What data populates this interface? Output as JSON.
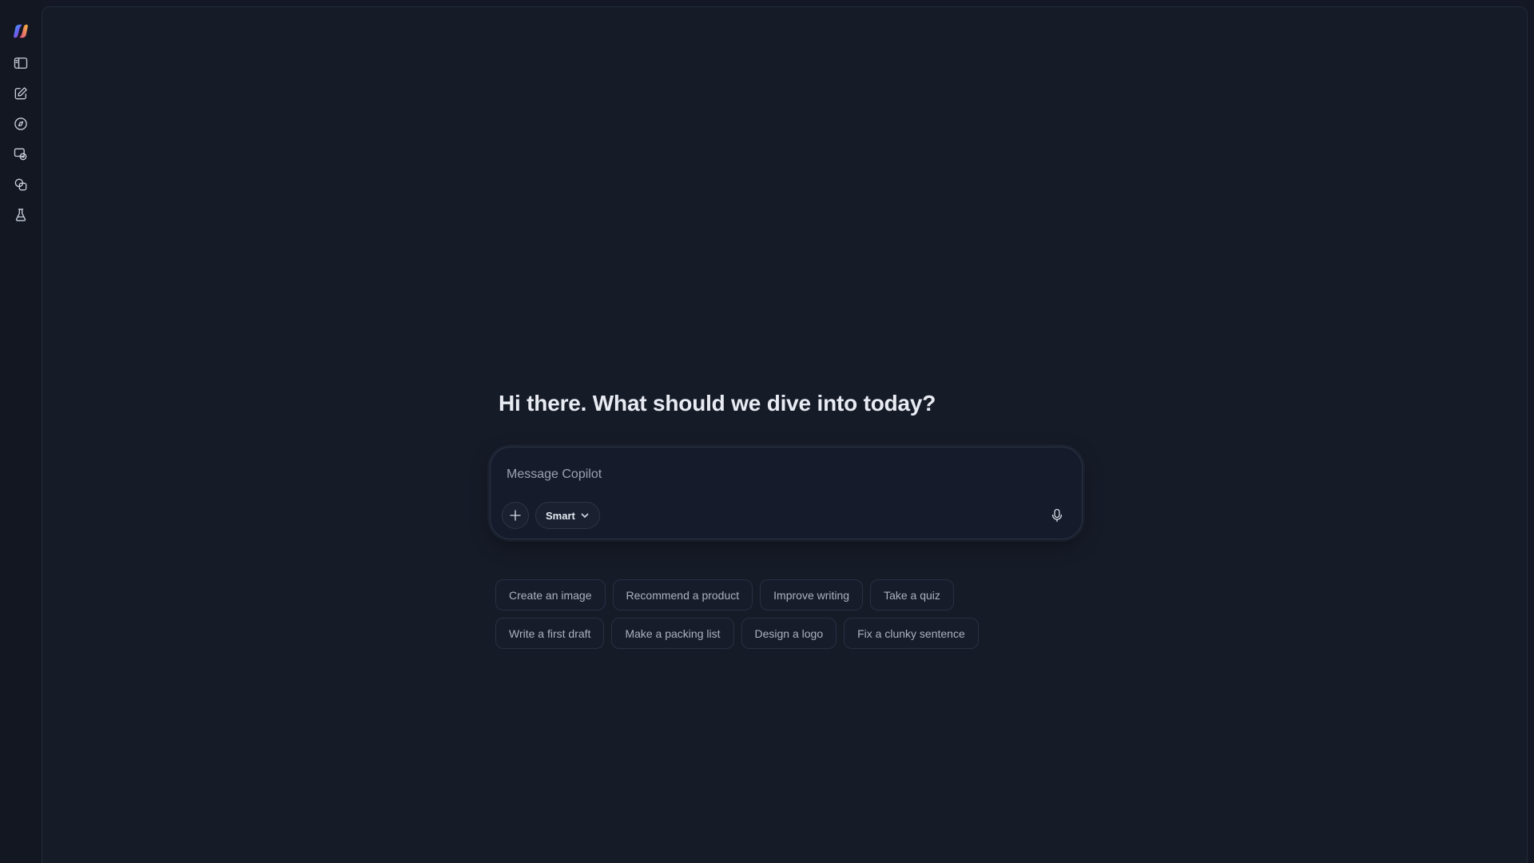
{
  "sidebar": {
    "items": [
      {
        "name": "copilot-logo",
        "icon": "copilot-logo-icon"
      },
      {
        "name": "toggle-sidebar",
        "icon": "sidebar-icon"
      },
      {
        "name": "new-chat",
        "icon": "compose-icon"
      },
      {
        "name": "discover",
        "icon": "compass-icon"
      },
      {
        "name": "create-image",
        "icon": "image-chat-icon"
      },
      {
        "name": "pages",
        "icon": "pages-icon"
      },
      {
        "name": "labs",
        "icon": "flask-icon"
      }
    ]
  },
  "main": {
    "greeting": "Hi there. What should we dive into today?"
  },
  "composer": {
    "placeholder": "Message Copilot",
    "value": "",
    "mode_label": "Smart"
  },
  "suggestions": {
    "row1": [
      "Create an image",
      "Recommend a product",
      "Improve writing",
      "Take a quiz"
    ],
    "row2": [
      "Write a first draft",
      "Make a packing list",
      "Design a logo",
      "Fix a clunky sentence"
    ]
  },
  "colors": {
    "background": "#131824",
    "panel": "#161b28",
    "text": "#e8ebf2",
    "muted": "#aab2c0",
    "border": "#283042"
  }
}
